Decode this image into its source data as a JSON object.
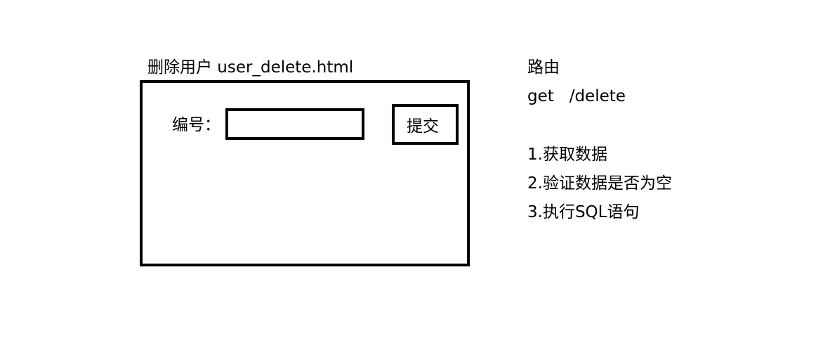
{
  "mockup": {
    "caption": "删除用户 user_delete.html",
    "field_label": "编号：",
    "field_value": "",
    "submit_label": "提交"
  },
  "notes": {
    "route_heading": "路由",
    "route": "get   /delete",
    "steps": [
      "1.获取数据",
      "2.验证数据是否为空",
      "3.执行SQL语句"
    ]
  }
}
